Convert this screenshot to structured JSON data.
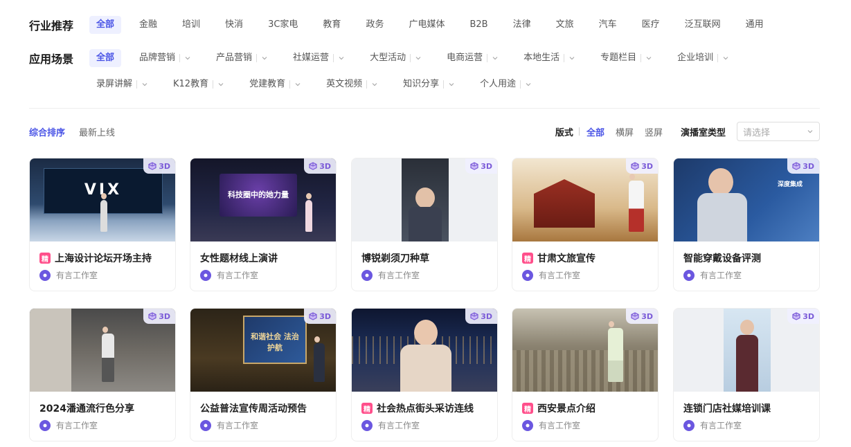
{
  "industry": {
    "label": "行业推荐",
    "items": [
      "全部",
      "金融",
      "培训",
      "快消",
      "3C家电",
      "教育",
      "政务",
      "广电媒体",
      "B2B",
      "法律",
      "文旅",
      "汽车",
      "医疗",
      "泛互联网",
      "通用"
    ]
  },
  "scenes": {
    "label": "应用场景",
    "row1": [
      "全部",
      "品牌营销",
      "产品营销",
      "社媒运营",
      "大型活动",
      "电商运营",
      "本地生活",
      "专题栏目",
      "企业培训"
    ],
    "row2": [
      "录屏讲解",
      "K12教育",
      "党建教育",
      "英文视频",
      "知识分享",
      "个人用途"
    ]
  },
  "sort": {
    "items": [
      "综合排序",
      "最新上线"
    ]
  },
  "format": {
    "label": "版式",
    "items": [
      "全部",
      "横屏",
      "竖屏"
    ],
    "studio_label": "演播室类型",
    "select_placeholder": "请选择"
  },
  "badge_text": "3D",
  "featured_mark": "精",
  "colors": {
    "accent": "#4b55e6",
    "featured": "#ff4f8b",
    "badge": "#7b5bd8"
  },
  "cards": [
    {
      "title": "上海设计论坛开场主持",
      "author": "有言工作室",
      "featured": true,
      "badge": true,
      "screen": "VIX"
    },
    {
      "title": "女性题材线上演讲",
      "author": "有言工作室",
      "featured": false,
      "badge": true,
      "screen": "科技圈中的她力量"
    },
    {
      "title": "博锐剃须刀种草",
      "author": "有言工作室",
      "featured": false,
      "badge": true,
      "screen": ""
    },
    {
      "title": "甘肃文旅宣传",
      "author": "有言工作室",
      "featured": true,
      "badge": true,
      "screen": ""
    },
    {
      "title": "智能穿戴设备评测",
      "author": "有言工作室",
      "featured": false,
      "badge": true,
      "screen": "深度集成"
    },
    {
      "title": "2024潘通流行色分享",
      "author": "有言工作室",
      "featured": false,
      "badge": true,
      "screen": ""
    },
    {
      "title": "公益普法宣传周活动预告",
      "author": "有言工作室",
      "featured": false,
      "badge": true,
      "screen": "和谐社会 法治护航"
    },
    {
      "title": "社会热点街头采访连线",
      "author": "有言工作室",
      "featured": true,
      "badge": true,
      "screen": ""
    },
    {
      "title": "西安景点介绍",
      "author": "有言工作室",
      "featured": true,
      "badge": true,
      "screen": ""
    },
    {
      "title": "连锁门店社媒培训课",
      "author": "有言工作室",
      "featured": false,
      "badge": true,
      "screen": ""
    }
  ]
}
